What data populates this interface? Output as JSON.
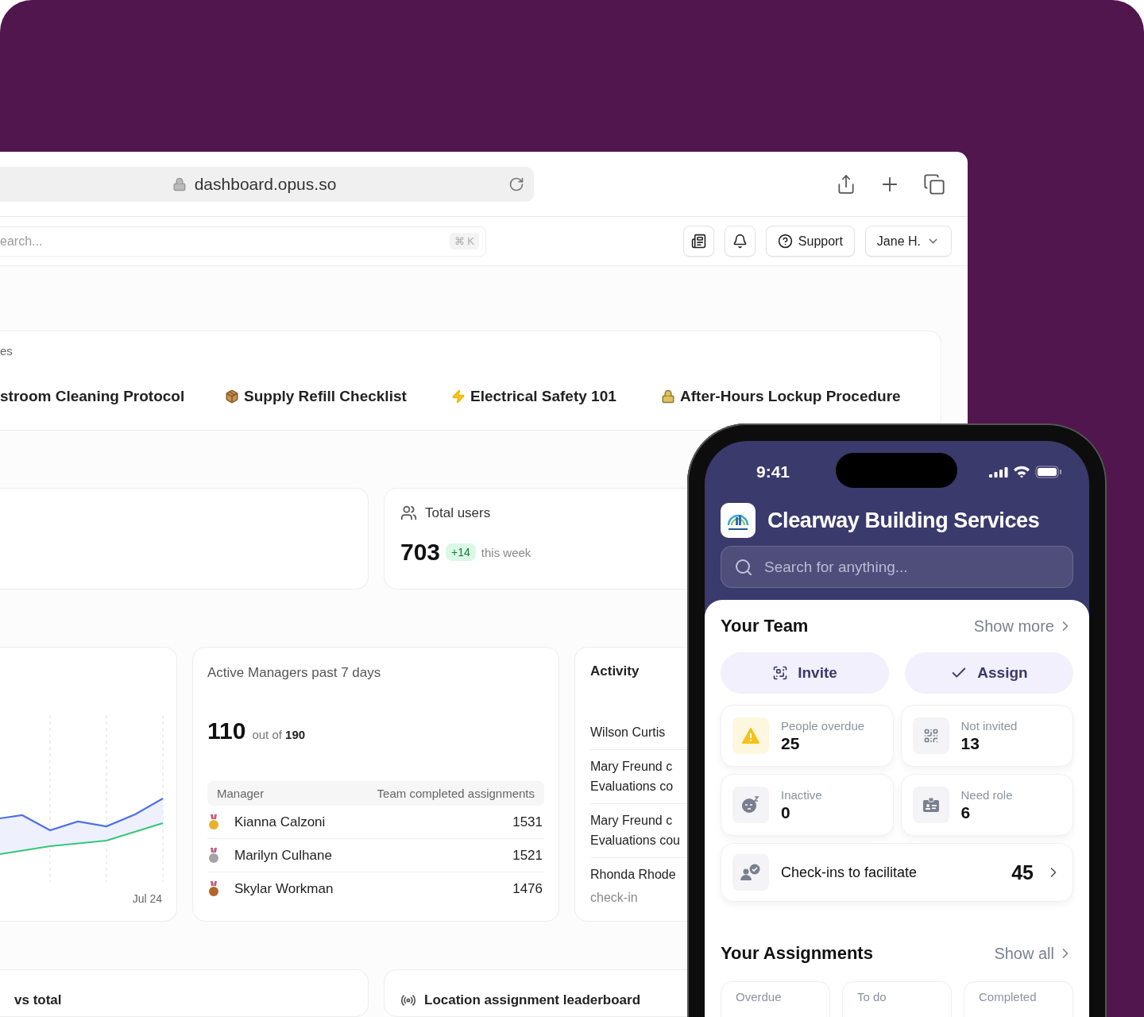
{
  "browser": {
    "url": "dashboard.opus.so"
  },
  "toolbar": {
    "search": {
      "placeholder": "earch...",
      "shortcut": "⌘ K"
    },
    "support": "Support",
    "user": "Jane H."
  },
  "courses": {
    "title": "es",
    "items": [
      {
        "label": "stroom Cleaning Protocol",
        "kind": "plain"
      },
      {
        "label": "Supply Refill Checklist",
        "kind": "box"
      },
      {
        "label": "Electrical Safety 101",
        "kind": "bolt"
      },
      {
        "label": "After-Hours Lockup Procedure",
        "kind": "lock"
      }
    ]
  },
  "total_users": {
    "label": "Total users",
    "value": "703",
    "change": "+14",
    "period": "this week"
  },
  "trend_card": {
    "x_label": "Jul 24"
  },
  "active_managers": {
    "title": "Active Managers past 7 days",
    "value": "110",
    "out_of": "out of **190**",
    "columns": [
      "Manager",
      "Team completed assignments"
    ],
    "rows": [
      {
        "name": "Kianna Calzoni",
        "count": "1531",
        "color": "#e8b12c"
      },
      {
        "name": "Marilyn Culhane",
        "count": "1521",
        "color": "#a3a3a8"
      },
      {
        "name": "Skylar Workman",
        "count": "1476",
        "color": "#b5642a"
      }
    ]
  },
  "activity": {
    "title": "Activity",
    "items": [
      {
        "lines": [
          "Wilson Curtis"
        ]
      },
      {
        "lines": [
          "Mary Freund c",
          "Evaluations co"
        ]
      },
      {
        "lines": [
          "Mary Freund c",
          "Evaluations cou"
        ]
      },
      {
        "lines": [
          "Rhonda Rhode"
        ],
        "note": "check-in"
      }
    ]
  },
  "bottom_cards": [
    {
      "title": "vs total",
      "kind": "plain"
    },
    {
      "title": "Location assignment leaderboard",
      "kind": "location"
    }
  ],
  "phone": {
    "time": "9:41",
    "org": "Clearway Building Services",
    "search_placeholder": "Search for anything...",
    "team": {
      "title": "Your Team",
      "link": "Show more",
      "actions": [
        {
          "label": "Invite",
          "kind": "scan"
        },
        {
          "label": "Assign",
          "kind": "check"
        }
      ],
      "stats": [
        {
          "label": "People overdue",
          "value": "25",
          "kind": "warning"
        },
        {
          "label": "Not invited",
          "value": "13",
          "kind": "qr"
        },
        {
          "label": "Inactive",
          "value": "0",
          "kind": "sleep"
        },
        {
          "label": "Need role",
          "value": "6",
          "kind": "badge"
        }
      ],
      "checkins": {
        "label": "Check-ins to facilitate",
        "value": "45"
      }
    },
    "assignments": {
      "title": "Your Assignments",
      "link": "Show all",
      "tabs": [
        "Overdue",
        "To do",
        "Completed"
      ]
    }
  }
}
